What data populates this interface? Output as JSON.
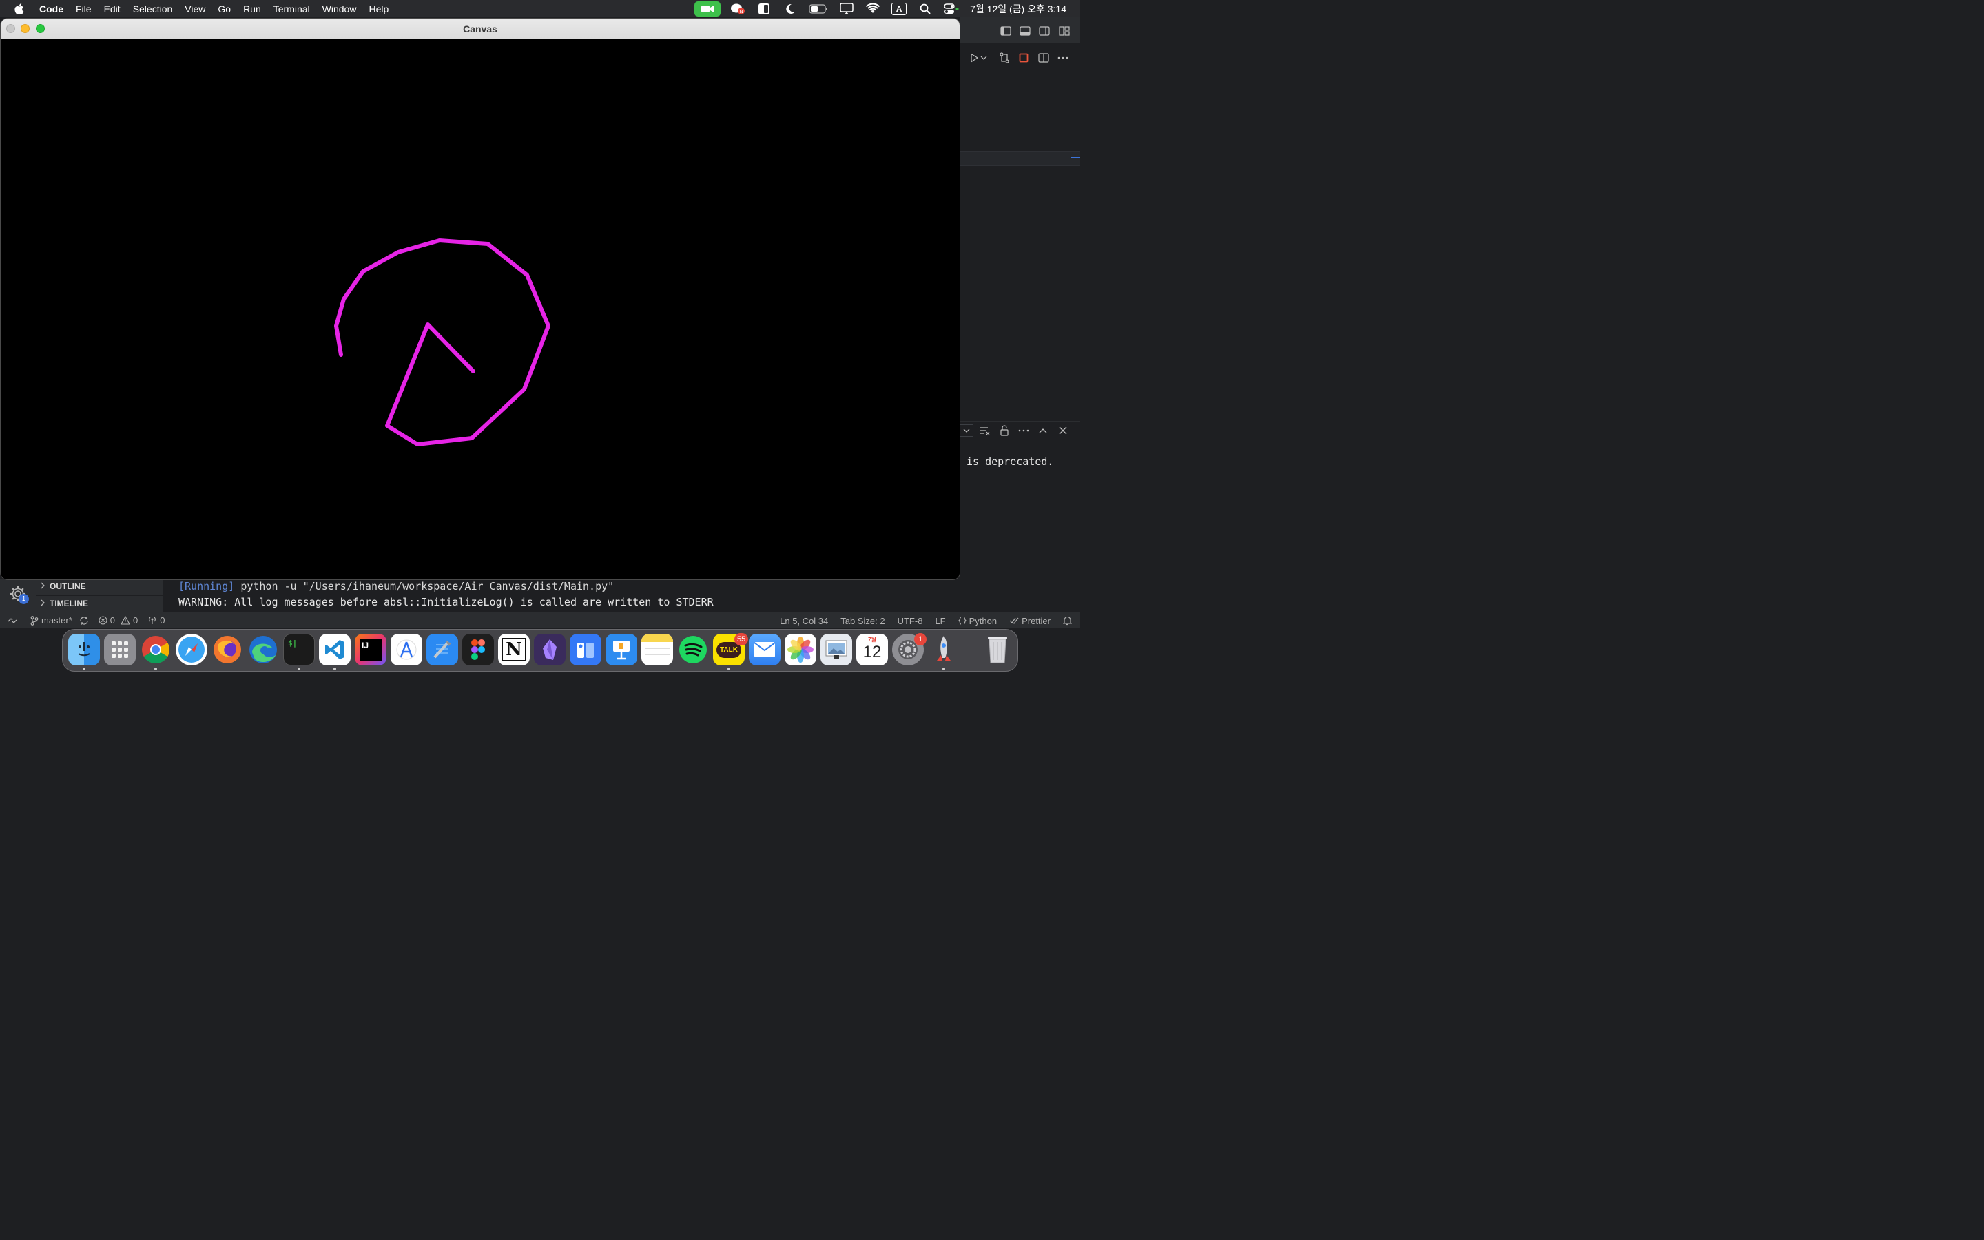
{
  "menubar": {
    "app_name": "Code",
    "menus": [
      "File",
      "Edit",
      "Selection",
      "View",
      "Go",
      "Run",
      "Terminal",
      "Window",
      "Help"
    ],
    "input_source": "A",
    "clock": "7월 12일 (금) 오후 3:14"
  },
  "canvas_window": {
    "title": "Canvas",
    "stroke_color": "#e624e6"
  },
  "vscode": {
    "output_fragment": "is deprecated.",
    "sidebar_sections": [
      "OUTLINE",
      "TIMELINE"
    ],
    "settings_badge": "1",
    "terminal": {
      "run_tag": "[Running]",
      "run_command": "python -u \"/Users/ihaneum/workspace/Air_Canvas/dist/Main.py\"",
      "warning": "WARNING: All log messages before absl::InitializeLog() is called are written to STDERR"
    },
    "statusbar": {
      "branch": "master*",
      "errors": "0",
      "warnings": "0",
      "ports": "0",
      "cursor_position": "Ln 5, Col 34",
      "tab_size": "Tab Size: 2",
      "encoding": "UTF-8",
      "eol": "LF",
      "language": "Python",
      "formatter": "Prettier"
    }
  },
  "dock": {
    "apps": [
      {
        "name": "Finder",
        "icon": "finder-icon",
        "color": "#2f8fe8"
      },
      {
        "name": "Launchpad",
        "icon": "launchpad-icon",
        "color": "#8e8e93"
      },
      {
        "name": "Chrome",
        "icon": "chrome-icon",
        "color": "#ffffff"
      },
      {
        "name": "Safari",
        "icon": "safari-icon",
        "color": "#3aa4f2"
      },
      {
        "name": "Firefox",
        "icon": "firefox-icon",
        "color": "#f2762e"
      },
      {
        "name": "Edge",
        "icon": "edge-icon",
        "color": "#2fb1c9"
      },
      {
        "name": "Terminal",
        "icon": "terminal-icon",
        "color": "#1b1b1b"
      },
      {
        "name": "VS Code",
        "icon": "vscode-icon",
        "color": "#ffffff"
      },
      {
        "name": "IntelliJ IDEA",
        "icon": "intellij-icon",
        "color": "#e8356e"
      },
      {
        "name": "Instruments",
        "icon": "instruments-icon",
        "color": "#ffffff"
      },
      {
        "name": "Xcode",
        "icon": "xcode-icon",
        "color": "#2b8af2"
      },
      {
        "name": "Figma",
        "icon": "figma-icon",
        "color": "#1e1e1e"
      },
      {
        "name": "Notion",
        "icon": "notion-icon",
        "color": "#ffffff"
      },
      {
        "name": "Obsidian",
        "icon": "obsidian-icon",
        "color": "#3a2b5c"
      },
      {
        "name": "Clipboard",
        "icon": "clipboard-icon",
        "color": "#3478f6"
      },
      {
        "name": "Keynote",
        "icon": "keynote-icon",
        "color": "#2d8cf0"
      },
      {
        "name": "Notes",
        "icon": "notes-icon",
        "color": "#f8d64e"
      },
      {
        "name": "Spotify",
        "icon": "spotify-icon",
        "color": "#1ed760"
      },
      {
        "name": "KakaoTalk",
        "icon": "kakaotalk-icon",
        "color": "#fae100",
        "badge": "55"
      },
      {
        "name": "Mail",
        "icon": "mail-icon",
        "color": "#3d8df5"
      },
      {
        "name": "Photos",
        "icon": "photos-icon",
        "color": "#ffffff"
      },
      {
        "name": "Preview",
        "icon": "preview-icon",
        "color": "#8fb8e0"
      },
      {
        "name": "Calendar",
        "icon": "calendar-icon",
        "color": "#ffffff",
        "month": "7월",
        "day": "12"
      },
      {
        "name": "System Settings",
        "icon": "settings-icon",
        "color": "#8e8e93",
        "badge": "1"
      },
      {
        "name": "Rocket",
        "icon": "rocket-icon",
        "color": "#5c5c60"
      },
      {
        "name": "Trash",
        "icon": "trash-icon",
        "color": "#d8d8dc"
      }
    ]
  }
}
